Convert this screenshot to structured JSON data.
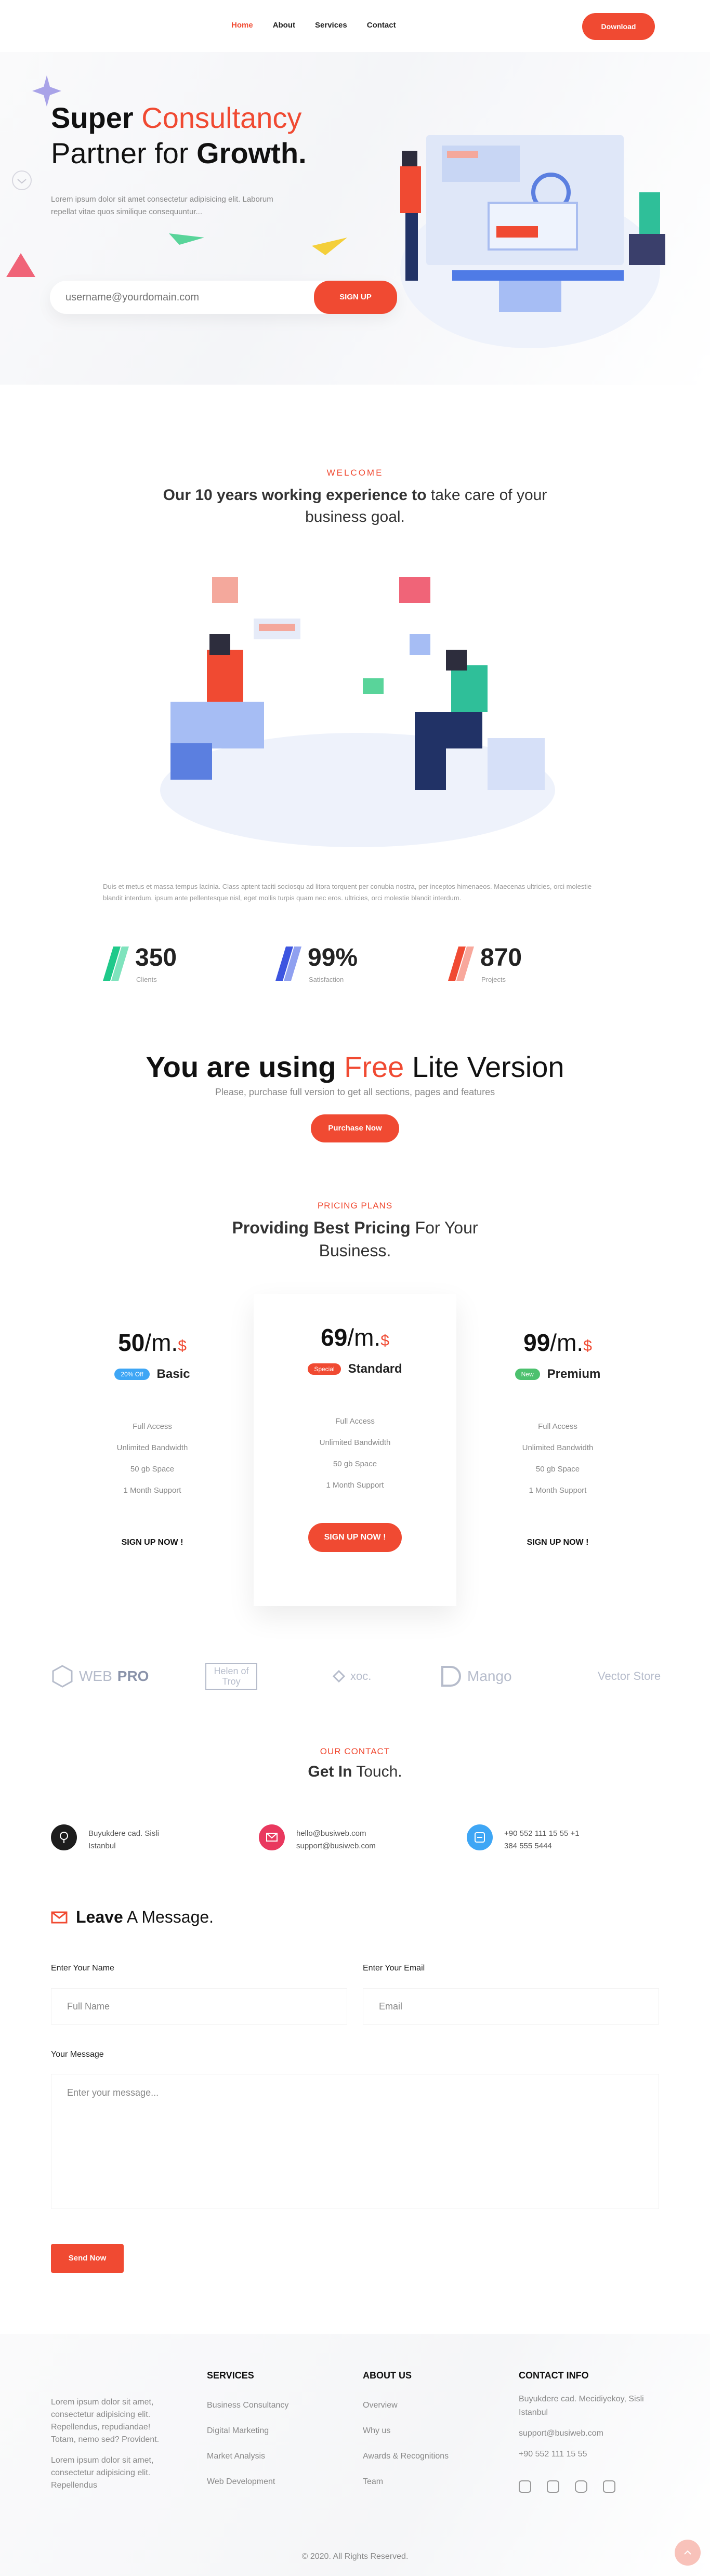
{
  "nav": {
    "items": [
      "Home",
      "About",
      "Services",
      "Contact"
    ],
    "download": "Download"
  },
  "hero": {
    "title_1": "Super ",
    "title_accent": "Consultancy",
    "title_2": "Partner for ",
    "title_bold": "Growth.",
    "subtitle": "Lorem ipsum dolor sit amet consectetur adipisicing elit. Laborum repellat vitae quos similique consequuntur...",
    "email_placeholder": "username@yourdomain.com",
    "signup": "SIGN UP"
  },
  "welcome": {
    "eyebrow": "WELCOME",
    "title_bold": "Our 10 years working experience to",
    "title_rest": " take care of your business goal.",
    "paragraph": "Duis et metus et massa tempus lacinia. Class aptent taciti sociosqu ad litora torquent per conubia nostra, per inceptos himenaeos. Maecenas ultricies, orci molestie blandit interdum. ipsum ante pellentesque nisl, eget mollis turpis quam nec eros. ultricies, orci molestie blandit interdum."
  },
  "stats": [
    {
      "value": "350",
      "label": "Clients",
      "color": "#1fc98a"
    },
    {
      "value": "99%",
      "label": "Satisfaction",
      "color": "#3d55e0"
    },
    {
      "value": "870",
      "label": "Projects",
      "color": "#f04a32"
    }
  ],
  "lite": {
    "title_bold": "You are using ",
    "title_accent": "Free",
    "title_rest": " Lite Version",
    "subtitle": "Please, purchase full version to get all sections, pages and features",
    "button": "Purchase Now"
  },
  "pricing": {
    "eyebrow": "PRICING PLANS",
    "title_bold": "Providing Best Pricing",
    "title_rest": " For Your Business.",
    "per": "/m.",
    "currency": "$",
    "plans": [
      {
        "price": "50",
        "badge": "20% Off",
        "badge_color": "#3ea6f5",
        "name": "Basic",
        "features": [
          "Full Access",
          "Unlimited Bandwidth",
          "50 gb Space",
          "1 Month Support"
        ],
        "cta": "SIGN UP NOW !"
      },
      {
        "price": "69",
        "badge": "Special",
        "badge_color": "#f04a32",
        "name": "Standard",
        "features": [
          "Full Access",
          "Unlimited Bandwidth",
          "50 gb Space",
          "1 Month Support"
        ],
        "cta": "SIGN UP NOW !"
      },
      {
        "price": "99",
        "badge": "New",
        "badge_color": "#4cc16e",
        "name": "Premium",
        "features": [
          "Full Access",
          "Unlimited Bandwidth",
          "50 gb Space",
          "1 Month Support"
        ],
        "cta": "SIGN UP NOW !"
      }
    ]
  },
  "clients": {
    "webpro_a": "WEB",
    "webpro_b": "PRO",
    "helen": "Helen of Troy",
    "xoc": "xoc.",
    "mango": "Mango",
    "vector": "Vector Store"
  },
  "contact": {
    "eyebrow": "OUR CONTACT",
    "title_bold": "Get In",
    "title_rest": " Touch.",
    "address": "Buyukdere cad. Sisli Istanbul",
    "emails": "hello@busiweb.com support@busiweb.com",
    "phones": "+90 552 111 15 55 +1 384 555 5444"
  },
  "form": {
    "title_bold": "Leave",
    "title_rest": " A Message.",
    "name_label": "Enter Your Name",
    "name_placeholder": "Full Name",
    "email_label": "Enter Your Email",
    "email_placeholder": "Email",
    "message_label": "Your Message",
    "message_placeholder": "Enter your message...",
    "send": "Send Now"
  },
  "footer": {
    "about_1": "Lorem ipsum dolor sit amet, consectetur adipisicing elit. Repellendus, repudiandae! Totam, nemo sed? Provident.",
    "about_2": "Lorem ipsum dolor sit amet, consectetur adipisicing elit. Repellendus",
    "services_title": "SERVICES",
    "services": [
      "Business Consultancy",
      "Digital Marketing",
      "Market Analysis",
      "Web Development"
    ],
    "about_title": "ABOUT US",
    "about_links": [
      "Overview",
      "Why us",
      "Awards & Recognitions",
      "Team"
    ],
    "contact_title": "CONTACT INFO",
    "contact_address": "Buyukdere cad. Mecidiyekoy, Sisli Istanbul",
    "contact_email": "support@busiweb.com",
    "contact_phone": "+90 552 111 15 55",
    "copyright": "© 2020. All Rights Reserved."
  }
}
